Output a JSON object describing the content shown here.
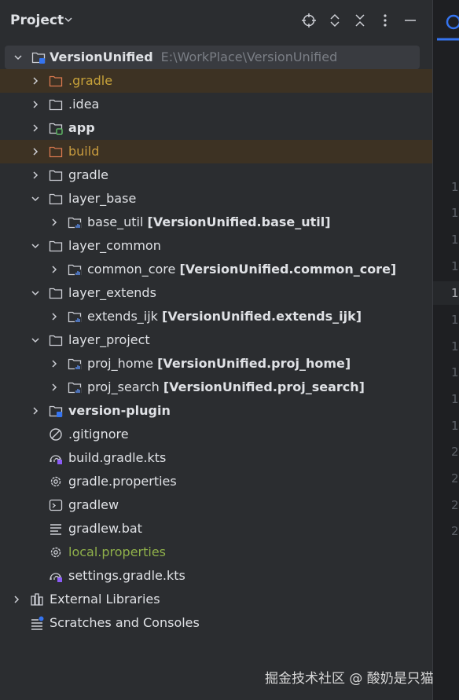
{
  "header": {
    "title": "Project",
    "icons": [
      "locate-icon",
      "expand-icon",
      "collapse-icon",
      "more-icon",
      "minimize-icon"
    ]
  },
  "tree": [
    {
      "label": "VersionUnified",
      "path": "E:\\WorkPlace\\VersionUnified",
      "icon": "module-folder-icon",
      "expanded": true
    },
    {
      "label": ".gradle",
      "icon": "excluded-folder-icon",
      "color": "#c7a23a"
    },
    {
      "label": ".idea",
      "icon": "folder-icon"
    },
    {
      "label": "app",
      "icon": "module-folder-icon"
    },
    {
      "label": "build",
      "icon": "excluded-folder-icon",
      "color": "#c89b3e"
    },
    {
      "label": "gradle",
      "icon": "folder-icon"
    },
    {
      "label": "layer_base",
      "icon": "folder-icon",
      "expanded": true
    },
    {
      "label": "base_util",
      "module": "[VersionUnified.base_util]",
      "icon": "module-folder-icon"
    },
    {
      "label": "layer_common",
      "icon": "folder-icon",
      "expanded": true
    },
    {
      "label": "common_core",
      "module": "[VersionUnified.common_core]",
      "icon": "module-folder-icon"
    },
    {
      "label": "layer_extends",
      "icon": "folder-icon",
      "expanded": true
    },
    {
      "label": "extends_ijk",
      "module": "[VersionUnified.extends_ijk]",
      "icon": "module-folder-icon"
    },
    {
      "label": "layer_project",
      "icon": "folder-icon",
      "expanded": true
    },
    {
      "label": "proj_home",
      "module": "[VersionUnified.proj_home]",
      "icon": "module-folder-icon"
    },
    {
      "label": "proj_search",
      "module": "[VersionUnified.proj_search]",
      "icon": "module-folder-icon"
    },
    {
      "label": "version-plugin",
      "icon": "module-folder-icon"
    },
    {
      "label": ".gitignore",
      "icon": "ignore-file-icon"
    },
    {
      "label": "build.gradle.kts",
      "icon": "gradle-kts-icon"
    },
    {
      "label": "gradle.properties",
      "icon": "gear-icon"
    },
    {
      "label": "gradlew",
      "icon": "terminal-icon"
    },
    {
      "label": "gradlew.bat",
      "icon": "text-file-icon"
    },
    {
      "label": "local.properties",
      "icon": "gear-icon",
      "color": "#8fb04a"
    },
    {
      "label": "settings.gradle.kts",
      "icon": "gradle-kts-icon"
    },
    {
      "label": "External Libraries",
      "icon": "library-icon"
    },
    {
      "label": "Scratches and Consoles",
      "icon": "scratches-icon"
    }
  ],
  "gutter_numbers": [
    "1",
    "1",
    "1",
    "1",
    "1",
    "1",
    "1",
    "1",
    "1",
    "1",
    "2",
    "2",
    "2",
    "2"
  ],
  "watermark": "掘金技术社区 @ 酸奶是只猫"
}
